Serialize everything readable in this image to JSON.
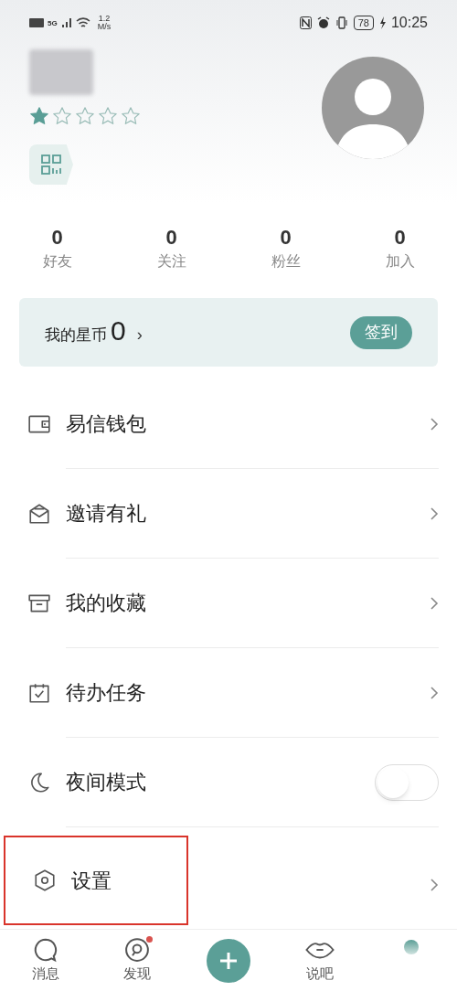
{
  "status_bar": {
    "network": "5G",
    "speed_value": "1.2",
    "speed_unit": "M/s",
    "battery": "78",
    "time": "10:25"
  },
  "profile": {
    "stars": 1
  },
  "stats": [
    {
      "value": "0",
      "label": "好友"
    },
    {
      "value": "0",
      "label": "关注"
    },
    {
      "value": "0",
      "label": "粉丝"
    },
    {
      "value": "0",
      "label": "加入"
    }
  ],
  "coins": {
    "label": "我的星币",
    "value": "0",
    "chevron": "›",
    "button": "签到"
  },
  "menu": [
    {
      "kind": "link",
      "label": "易信钱包",
      "highlighted": false
    },
    {
      "kind": "link",
      "label": "邀请有礼",
      "highlighted": false
    },
    {
      "kind": "link",
      "label": "我的收藏",
      "highlighted": false
    },
    {
      "kind": "link",
      "label": "待办任务",
      "highlighted": false
    },
    {
      "kind": "toggle",
      "label": "夜间模式",
      "on": false,
      "highlighted": false
    },
    {
      "kind": "link",
      "label": "设置",
      "highlighted": true
    }
  ],
  "bottom_nav": [
    {
      "kind": "tab",
      "label": "消息",
      "badge": false
    },
    {
      "kind": "tab",
      "label": "发现",
      "badge": true
    },
    {
      "kind": "add"
    },
    {
      "kind": "tab",
      "label": "说吧",
      "badge": false
    },
    {
      "kind": "dot"
    }
  ]
}
